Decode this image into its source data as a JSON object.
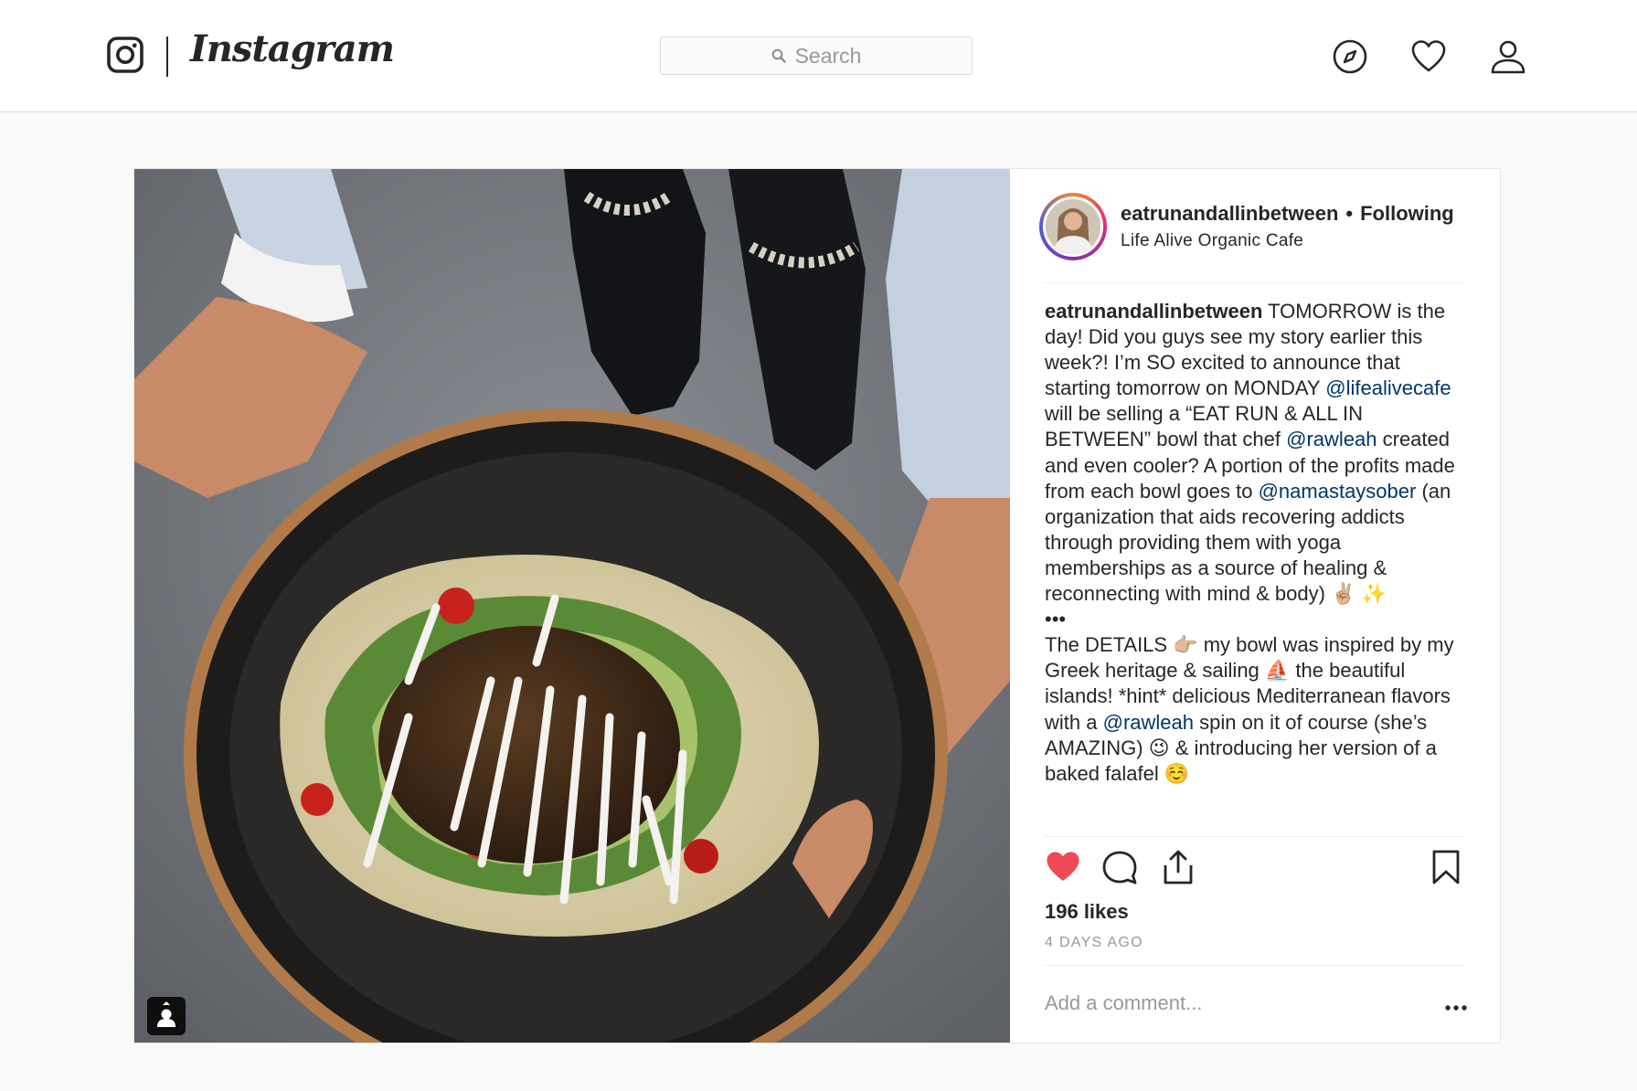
{
  "header": {
    "brand": "Instagram",
    "search": {
      "placeholder": "Search"
    },
    "icons": [
      "instagram-glyph-icon",
      "compass-icon",
      "heart-icon",
      "profile-icon"
    ]
  },
  "post": {
    "author": {
      "username": "eatrunandallinbetween",
      "follow_status": "Following",
      "location": "Life Alive Organic Cafe"
    },
    "caption": {
      "username": "eatrunandallinbetween",
      "text_1": "TOMORROW is the day! Did you guys see my story earlier this week?! I’m SO excited to announce that starting tomorrow on MONDAY",
      "mention_1": "@lifealivecafe",
      "text_2": "will be selling a “EAT RUN & ALL IN BETWEEN” bowl that chef",
      "mention_2": "@rawleah",
      "text_3": "created and even cooler? A portion of the profits made from each bowl goes to",
      "mention_3": "@namastaysober",
      "text_4": "(an organization that aids recovering addicts through providing them with yoga memberships as a source of healing & reconnecting with mind & body) ✌🏼 ✨",
      "divider": "•••",
      "text_5": "The DETAILS 👉🏼  my bowl was inspired by my Greek heritage & sailing ⛵  the beautiful islands! *hint* delicious Mediterranean flavors with a",
      "mention_4": "@rawleah",
      "text_6": "spin on it of course (she’s AMAZING) 😉  & introducing her version of a baked falafel ☺️"
    },
    "liked": true,
    "likes_text": "196 likes",
    "timestamp": "4 DAYS AGO",
    "comment_placeholder": "Add a comment...",
    "colors": {
      "like_red": "#ed4956",
      "mention_blue": "#003569",
      "muted": "#999999"
    }
  }
}
